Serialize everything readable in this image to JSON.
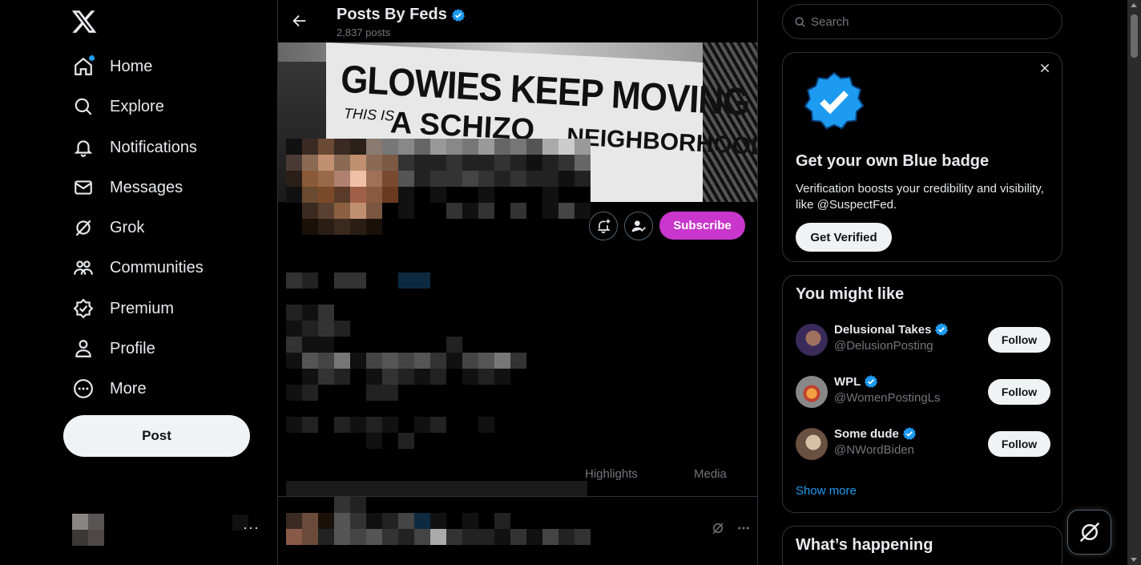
{
  "nav": {
    "items": [
      {
        "label": "Home",
        "icon": "home-icon",
        "notify": true
      },
      {
        "label": "Explore",
        "icon": "search-icon"
      },
      {
        "label": "Notifications",
        "icon": "bell-icon"
      },
      {
        "label": "Messages",
        "icon": "envelope-icon"
      },
      {
        "label": "Grok",
        "icon": "grok-icon"
      },
      {
        "label": "Communities",
        "icon": "people-icon"
      },
      {
        "label": "Premium",
        "icon": "premium-icon"
      },
      {
        "label": "Profile",
        "icon": "person-icon"
      },
      {
        "label": "More",
        "icon": "more-circle-icon"
      }
    ],
    "post_label": "Post",
    "account_more": "···"
  },
  "profile": {
    "name": "Posts By Feds",
    "post_count": "2,837 posts",
    "subscribe_label": "Subscribe",
    "banner_text": {
      "line1": "GLOWIES KEEP MOVING",
      "line2": "THIS IS",
      "line3": "A SCHIZO",
      "line4": "NEIGHBORHOOD."
    },
    "tabs": [
      "Highlights",
      "Media"
    ]
  },
  "search": {
    "placeholder": "Search"
  },
  "verify_card": {
    "title": "Get your own Blue badge",
    "description": "Verification boosts your credibility and visibility, like @SuspectFed.",
    "button_label": "Get Verified"
  },
  "who_to_follow": {
    "title": "You might like",
    "accounts": [
      {
        "name": "Delusional Takes",
        "handle": "@DelusionPosting",
        "verified": true
      },
      {
        "name": "WPL",
        "handle": "@WomenPostingLs",
        "verified": true
      },
      {
        "name": "Some dude",
        "handle": "@NWordBiden",
        "verified": true
      }
    ],
    "follow_label": "Follow",
    "show_more": "Show more"
  },
  "trending": {
    "title": "What’s happening"
  },
  "colors": {
    "accent": "#1d9bf0",
    "subscribe": "#c936cc",
    "background": "#000000",
    "border": "#2f3336",
    "muted_text": "#71767b"
  }
}
